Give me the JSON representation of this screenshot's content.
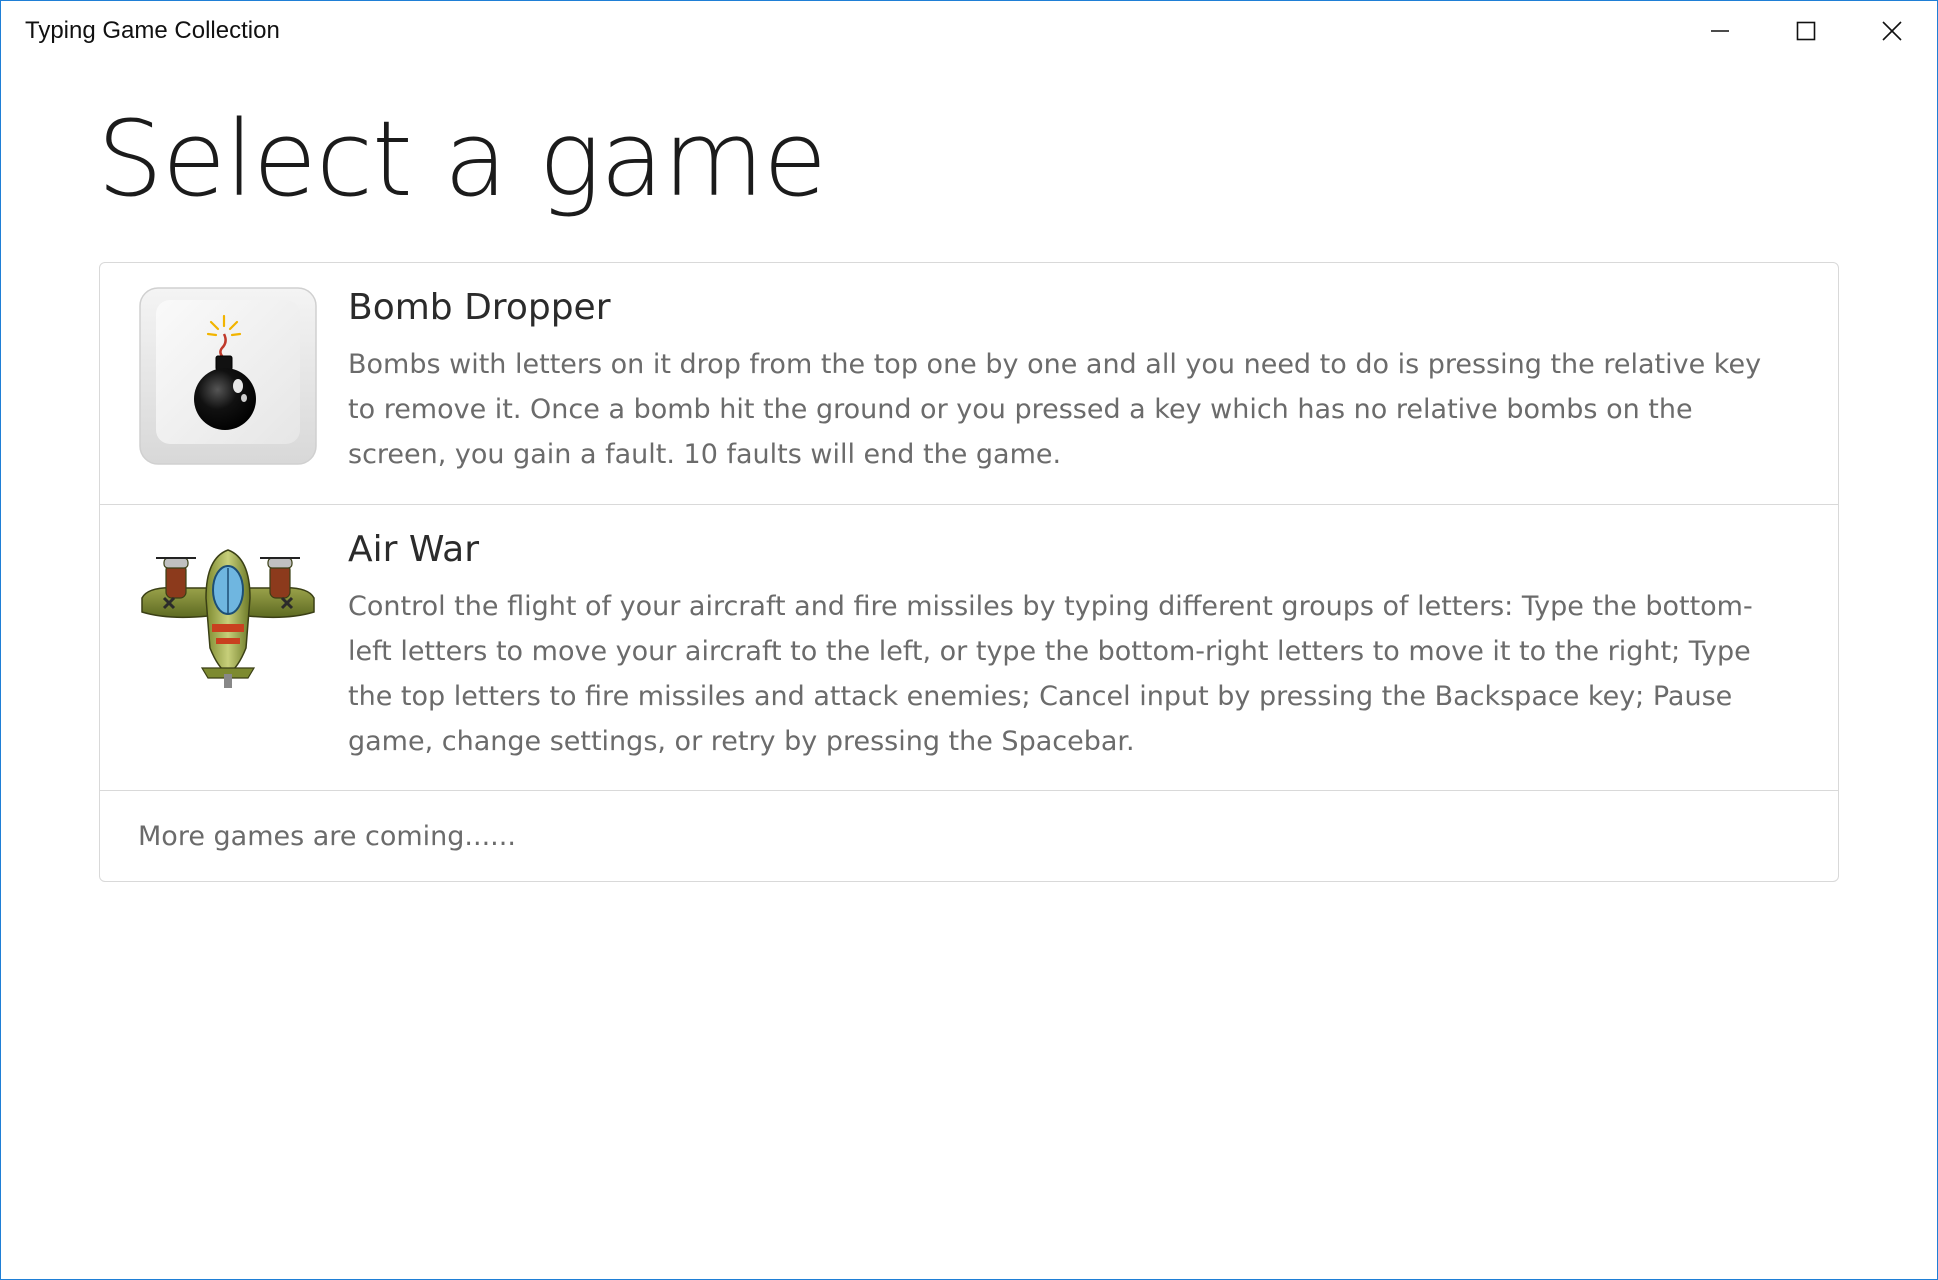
{
  "window": {
    "title": "Typing Game Collection",
    "controls": {
      "minimize_icon": "minimize-icon",
      "maximize_icon": "maximize-icon",
      "close_icon": "close-icon"
    },
    "border_color": "#1f7fd6"
  },
  "main": {
    "heading": "Select a game",
    "games": [
      {
        "title": "Bomb Dropper",
        "icon": "bomb-icon",
        "description": "Bombs with letters on it drop from the top one by one and all you need to do is pressing the relative key to remove it. Once a bomb hit the ground or you pressed a key which has no relative bombs on the screen, you gain a fault. 10 faults will end the game."
      },
      {
        "title": "Air War",
        "icon": "airplane-icon",
        "description": "Control the flight of your aircraft and fire missiles by typing different groups of letters: Type the bottom-left letters to move your aircraft to the left, or type the bottom-right letters to move it to the right; Type the top letters to fire missiles and attack enemies; Cancel input by pressing the Backspace key; Pause game, change settings, or retry by pressing the Spacebar."
      }
    ],
    "more_text": "More games are coming......"
  }
}
